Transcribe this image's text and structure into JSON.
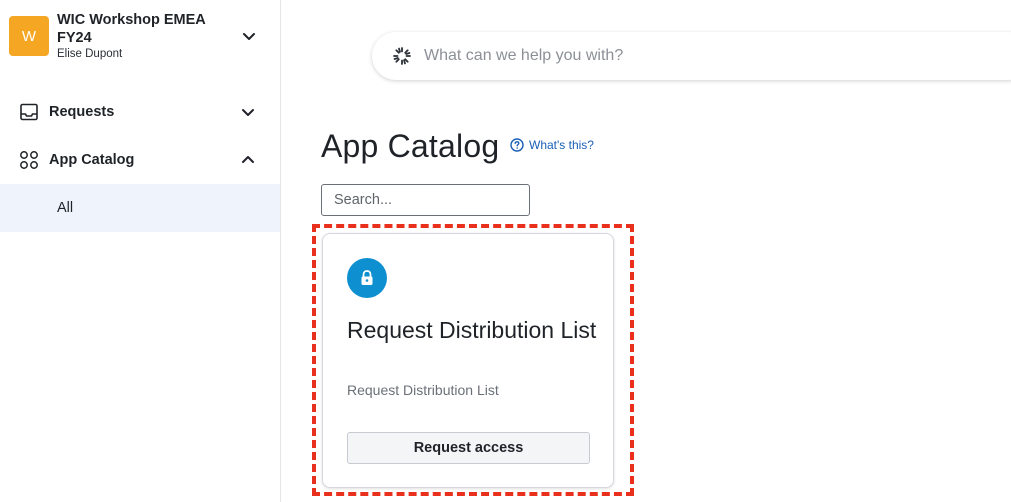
{
  "org": {
    "avatar_letter": "W",
    "name": "WIC Workshop EMEA FY24",
    "user": "Elise Dupont",
    "avatar_color": "#f5a623"
  },
  "sidebar": {
    "items": [
      {
        "label": "Requests",
        "icon": "inbox-icon",
        "expanded": false
      },
      {
        "label": "App Catalog",
        "icon": "apps-grid-icon",
        "expanded": true,
        "children": [
          {
            "label": "All",
            "selected": true
          }
        ]
      }
    ]
  },
  "search": {
    "placeholder": "What can we help you with?",
    "value": ""
  },
  "main": {
    "title": "App Catalog",
    "whats_this": "What's this?",
    "catalog_search_placeholder": "Search...",
    "cards": [
      {
        "title": "Request Distribution List",
        "description": "Request Distribution List",
        "icon": "lock-icon",
        "icon_color": "#0d8fd0",
        "button_label": "Request access"
      }
    ]
  },
  "colors": {
    "accent": "#1a5fb4",
    "highlight_border": "#e8301c",
    "selected_bg": "#eef3fc"
  }
}
